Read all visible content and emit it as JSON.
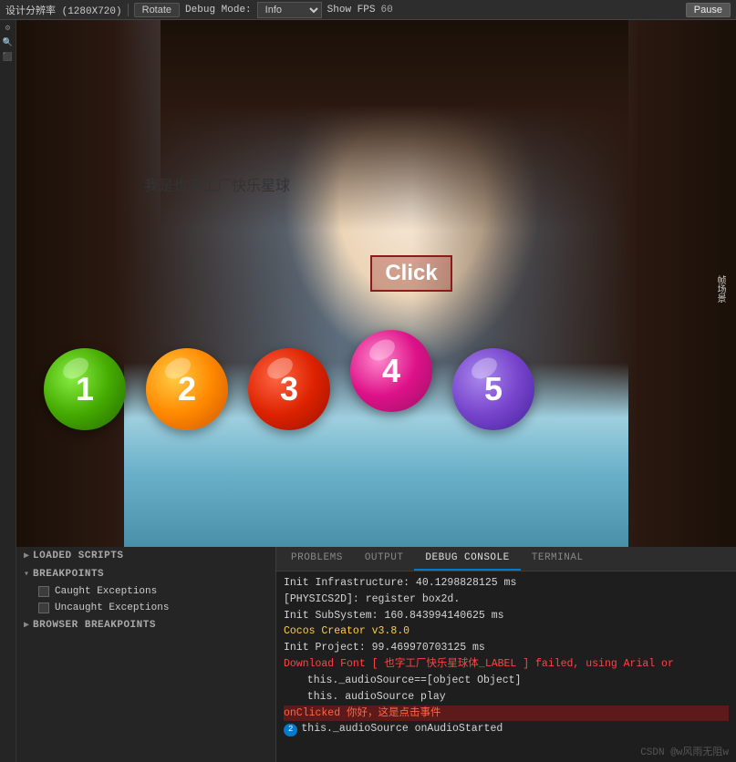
{
  "toolbar": {
    "resolution_label": "设计分辨率 (1280X720)",
    "rotate_btn": "Rotate",
    "debug_mode_label": "Debug Mode:",
    "debug_select": "Info",
    "show_fps_label": "Show FPS",
    "fps_value": "60",
    "pause_btn": "Pause"
  },
  "game": {
    "chinese_text": "我是也字工厂快乐星球",
    "click_label": "Click",
    "balls": [
      {
        "number": "1",
        "color_class": "ball-1"
      },
      {
        "number": "2",
        "color_class": "ball-2"
      },
      {
        "number": "3",
        "color_class": "ball-3"
      },
      {
        "number": "4",
        "color_class": "ball-4"
      },
      {
        "number": "5",
        "color_class": "ball-5"
      }
    ]
  },
  "left_panel": {
    "loaded_scripts_label": "LOADED SCRIPTS",
    "breakpoints_label": "BREAKPOINTS",
    "caught_exceptions_label": "Caught Exceptions",
    "uncaught_exceptions_label": "Uncaught Exceptions",
    "browser_breakpoints_label": "BROWSER BREAKPOINTS"
  },
  "console": {
    "tabs": [
      {
        "label": "PROBLEMS",
        "active": false
      },
      {
        "label": "OUTPUT",
        "active": false
      },
      {
        "label": "DEBUG CONSOLE",
        "active": true
      },
      {
        "label": "TERMINAL",
        "active": false
      }
    ],
    "lines": [
      {
        "text": "Init Infrastructure: 40.1298828125 ms",
        "type": "info"
      },
      {
        "text": "[PHYSICS2D]: register box2d.",
        "type": "info"
      },
      {
        "text": "Init SubSystem: 160.843994140625 ms",
        "type": "info"
      },
      {
        "text": "Cocos Creator v3.8.0",
        "type": "yellow"
      },
      {
        "text": "Init Project: 99.469970703125 ms",
        "type": "info"
      },
      {
        "text": "Download Font [ 也字工厂快乐星球体_LABEL ] failed, using Arial or",
        "type": "error"
      },
      {
        "text": "  this._audioSource==[object Object]",
        "type": "info"
      },
      {
        "text": "  this. audioSource play",
        "type": "info"
      },
      {
        "text": "onClicked 你好，这是点击事件",
        "type": "highlight"
      },
      {
        "text": "2  this._audioSource onAudioStarted",
        "type": "info",
        "badge": true
      }
    ]
  },
  "watermark": "CSDN @w风雨无阻w"
}
